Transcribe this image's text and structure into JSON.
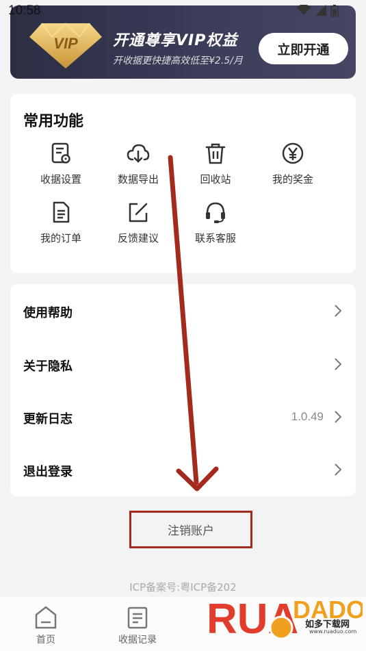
{
  "status": {
    "time": "10:58"
  },
  "vip": {
    "badge": "VIP",
    "title": "开通尊享VIP权益",
    "subtitle": "开收据更快捷高效低至¥2.5/月",
    "button": "立即开通"
  },
  "functions": {
    "title": "常用功能",
    "items": [
      {
        "label": "收据设置",
        "icon": "receipt-settings-icon"
      },
      {
        "label": "数据导出",
        "icon": "cloud-download-icon"
      },
      {
        "label": "回收站",
        "icon": "trash-icon"
      },
      {
        "label": "我的奖金",
        "icon": "yen-coin-icon"
      },
      {
        "label": "我的订单",
        "icon": "document-icon"
      },
      {
        "label": "反馈建议",
        "icon": "edit-icon"
      },
      {
        "label": "联系客服",
        "icon": "headset-icon"
      }
    ]
  },
  "menu": {
    "items": [
      {
        "label": "使用帮助",
        "value": ""
      },
      {
        "label": "关于隐私",
        "value": ""
      },
      {
        "label": "更新日志",
        "value": "1.0.49"
      },
      {
        "label": "退出登录",
        "value": ""
      }
    ]
  },
  "cancel_account": "注销账户",
  "icp": "ICP备案号:粤ICP备202",
  "tabs": [
    {
      "label": "首页",
      "icon": "home-icon"
    },
    {
      "label": "收据记录",
      "icon": "receipt-list-icon"
    }
  ],
  "watermark": {
    "brand": "RUANDADUO",
    "sub": "如多下载网",
    "url": "www.ruaduo.com"
  },
  "colors": {
    "vip_bg": "#2c2e44",
    "gold": "#e7b85a",
    "annotation_red": "#a52a1e"
  }
}
